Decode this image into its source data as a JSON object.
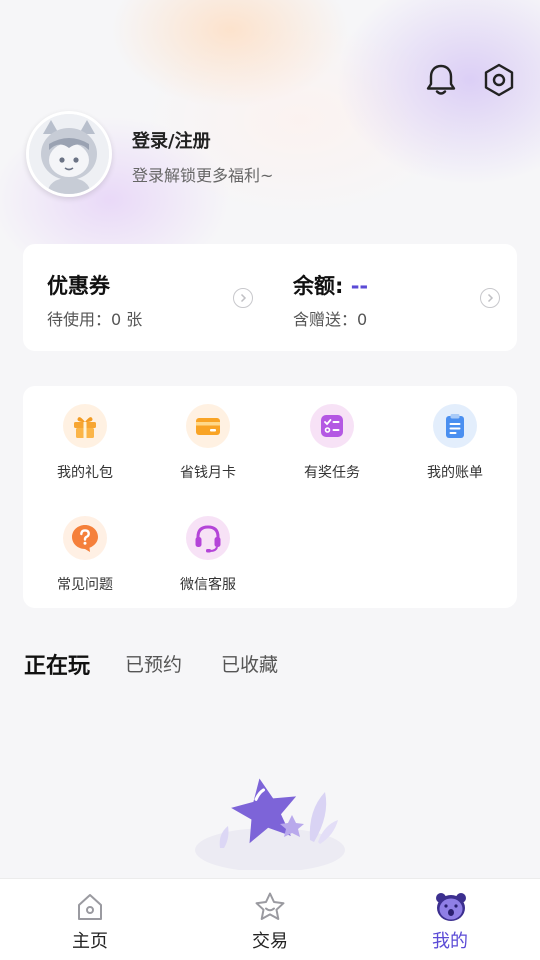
{
  "profile": {
    "login_title": "登录/注册",
    "login_subtitle": "登录解锁更多福利~"
  },
  "wallet": {
    "coupon_title": "优惠券",
    "coupon_sub": "待使用：0 张",
    "balance_title": "余额:",
    "balance_value": "--",
    "balance_sub": "含赠送：0"
  },
  "grid": [
    {
      "label": "我的礼包",
      "icon": "gift-icon"
    },
    {
      "label": "省钱月卡",
      "icon": "card-icon"
    },
    {
      "label": "有奖任务",
      "icon": "task-icon"
    },
    {
      "label": "我的账单",
      "icon": "bill-icon"
    },
    {
      "label": "常见问题",
      "icon": "question-icon"
    },
    {
      "label": "微信客服",
      "icon": "headset-icon"
    }
  ],
  "tabs": [
    "正在玩",
    "已预约",
    "已收藏"
  ],
  "nav": [
    {
      "label": "主页",
      "icon": "home-icon"
    },
    {
      "label": "交易",
      "icon": "star-icon"
    },
    {
      "label": "我的",
      "icon": "mine-icon"
    }
  ],
  "colors": {
    "accent": "#5b4bd6",
    "background": "#f6f6f8"
  }
}
